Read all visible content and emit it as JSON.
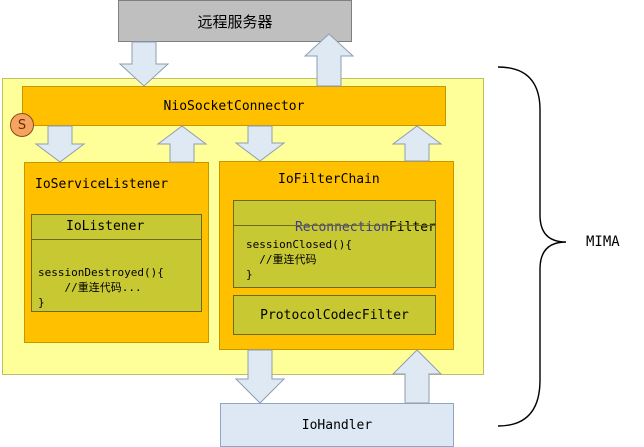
{
  "nodes": {
    "remote_server": "远程服务器",
    "connector": "NioSocketConnector",
    "connector_badge": "S",
    "service_listener": "IoServiceListener",
    "io_listener": "IoListener",
    "listener_code": [
      "sessionDestroyed(){",
      "    //重连代码...",
      "}"
    ],
    "filter_chain": "IoFilterChain",
    "reconnection_filter_prefix": "Reconnection",
    "reconnection_filter_suffix": "Filter",
    "filter_code": [
      "sessionClosed(){",
      "  //重连代码",
      "}"
    ],
    "protocol_filter": "ProtocolCodecFilter",
    "handler": "IoHandler",
    "framework": "MIMA"
  },
  "colors": {
    "outer_fill": "#ffff99",
    "orange_fill": "#ffc000",
    "olive_fill": "#c8c832",
    "gray_fill": "#bfbfbf",
    "handler_fill": "#dde8f4",
    "arrow_fill": "#dfe9f3",
    "badge_fill": "#f4a460",
    "accent_text": "#3a3a9a"
  }
}
